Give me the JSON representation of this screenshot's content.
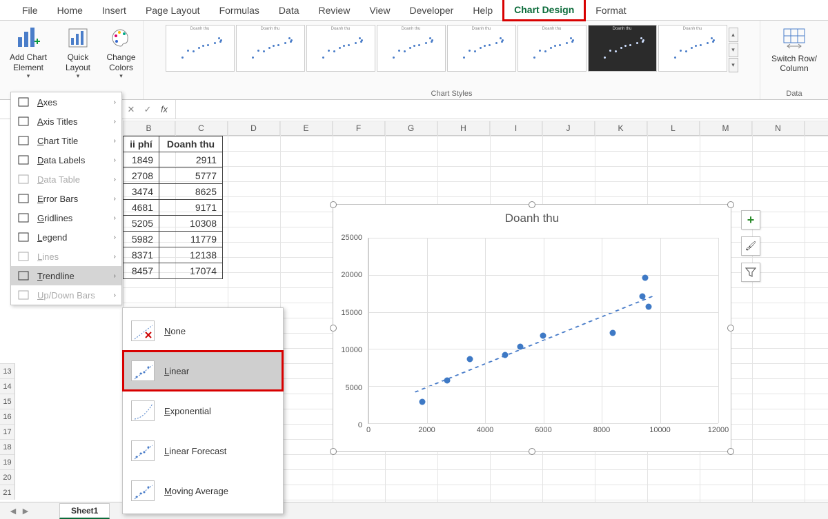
{
  "ribbon_tabs": [
    "File",
    "Home",
    "Insert",
    "Page Layout",
    "Formulas",
    "Data",
    "Review",
    "View",
    "Developer",
    "Help",
    "Chart Design",
    "Format"
  ],
  "active_tab": "Chart Design",
  "ribbon": {
    "add_chart_element": "Add Chart\nElement",
    "quick_layout": "Quick\nLayout",
    "change_colors": "Change\nColors",
    "switch_row_col": "Switch Row/\nColumn",
    "group_chart_styles": "Chart Styles",
    "group_data": "Data"
  },
  "dropdown_items": [
    {
      "label": "Axes",
      "key": "axes",
      "disabled": false
    },
    {
      "label": "Axis Titles",
      "key": "axis-titles",
      "disabled": false
    },
    {
      "label": "Chart Title",
      "key": "chart-title",
      "disabled": false
    },
    {
      "label": "Data Labels",
      "key": "data-labels",
      "disabled": false
    },
    {
      "label": "Data Table",
      "key": "data-table",
      "disabled": true
    },
    {
      "label": "Error Bars",
      "key": "error-bars",
      "disabled": false
    },
    {
      "label": "Gridlines",
      "key": "gridlines",
      "disabled": false
    },
    {
      "label": "Legend",
      "key": "legend",
      "disabled": false
    },
    {
      "label": "Lines",
      "key": "lines",
      "disabled": true
    },
    {
      "label": "Trendline",
      "key": "trendline",
      "disabled": false,
      "active": true
    },
    {
      "label": "Up/Down Bars",
      "key": "updown-bars",
      "disabled": true
    }
  ],
  "submenu_items": [
    {
      "label": "None",
      "key": "none"
    },
    {
      "label": "Linear",
      "key": "linear",
      "highlight": true,
      "hover": true
    },
    {
      "label": "Exponential",
      "key": "exponential"
    },
    {
      "label": "Linear Forecast",
      "key": "linear-forecast"
    },
    {
      "label": "Moving Average",
      "key": "moving-average"
    }
  ],
  "col_headers": [
    "B",
    "C",
    "D",
    "E",
    "F",
    "G",
    "H",
    "I",
    "J",
    "K",
    "L",
    "M",
    "N"
  ],
  "row_headers": [
    "13",
    "14",
    "15",
    "16",
    "17",
    "18",
    "19",
    "20",
    "21"
  ],
  "table": {
    "headerA": "ii phí",
    "headerB": "Doanh thu",
    "rows": [
      [
        "1849",
        "2911"
      ],
      [
        "2708",
        "5777"
      ],
      [
        "3474",
        "8625"
      ],
      [
        "4681",
        "9171"
      ],
      [
        "5205",
        "10308"
      ],
      [
        "5982",
        "11779"
      ],
      [
        "8371",
        "12138"
      ],
      [
        "8457",
        "17074"
      ]
    ]
  },
  "chart_data": {
    "type": "scatter",
    "title": "Doanh thu",
    "xlabel": "",
    "ylabel": "",
    "xlim": [
      0,
      12000
    ],
    "ylim": [
      0,
      25000
    ],
    "x_ticks": [
      0,
      2000,
      4000,
      6000,
      8000,
      10000,
      12000
    ],
    "y_ticks": [
      0,
      5000,
      10000,
      15000,
      20000,
      25000
    ],
    "trendline": "linear",
    "series": [
      {
        "name": "Doanh thu",
        "points": [
          {
            "x": 1849,
            "y": 2911
          },
          {
            "x": 2708,
            "y": 5777
          },
          {
            "x": 3474,
            "y": 8625
          },
          {
            "x": 4681,
            "y": 9171
          },
          {
            "x": 5205,
            "y": 10308
          },
          {
            "x": 5982,
            "y": 11779
          },
          {
            "x": 8371,
            "y": 12138
          },
          {
            "x": 9500,
            "y": 19600
          },
          {
            "x": 9400,
            "y": 17100
          },
          {
            "x": 9600,
            "y": 15700
          }
        ]
      }
    ]
  },
  "sheet": {
    "name": "Sheet1"
  },
  "formula_bar": {
    "fx": "fx"
  }
}
